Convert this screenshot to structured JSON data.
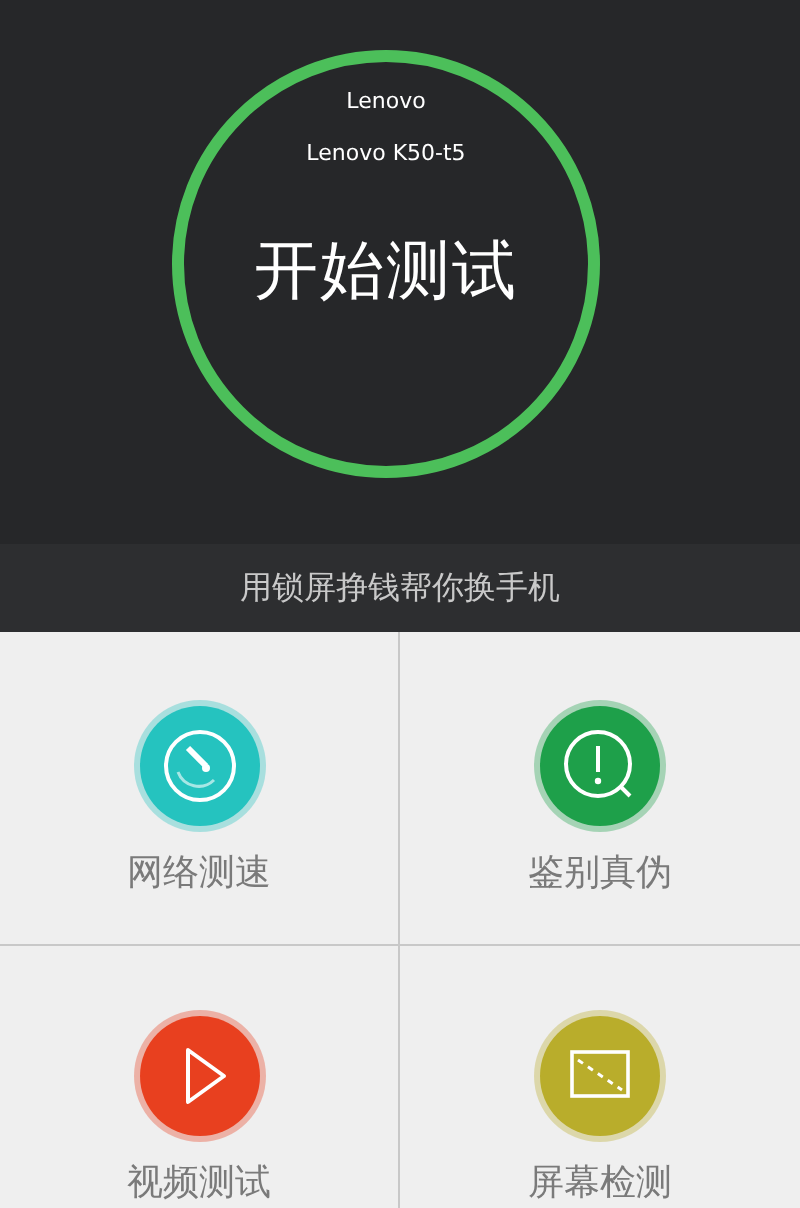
{
  "device": {
    "brand": "Lenovo",
    "model": "Lenovo K50-t5"
  },
  "start_button": {
    "label": "开始测试"
  },
  "banner": {
    "text": "用锁屏挣钱帮你换手机"
  },
  "tools": [
    {
      "kind": "speed",
      "label": "网络测速",
      "color": "#25c3bf"
    },
    {
      "kind": "verify",
      "label": "鉴别真伪",
      "color": "#1ea04a"
    },
    {
      "kind": "video",
      "label": "视频测试",
      "color": "#e8401f"
    },
    {
      "kind": "screen",
      "label": "屏幕检测",
      "color": "#b9ad2b"
    }
  ]
}
